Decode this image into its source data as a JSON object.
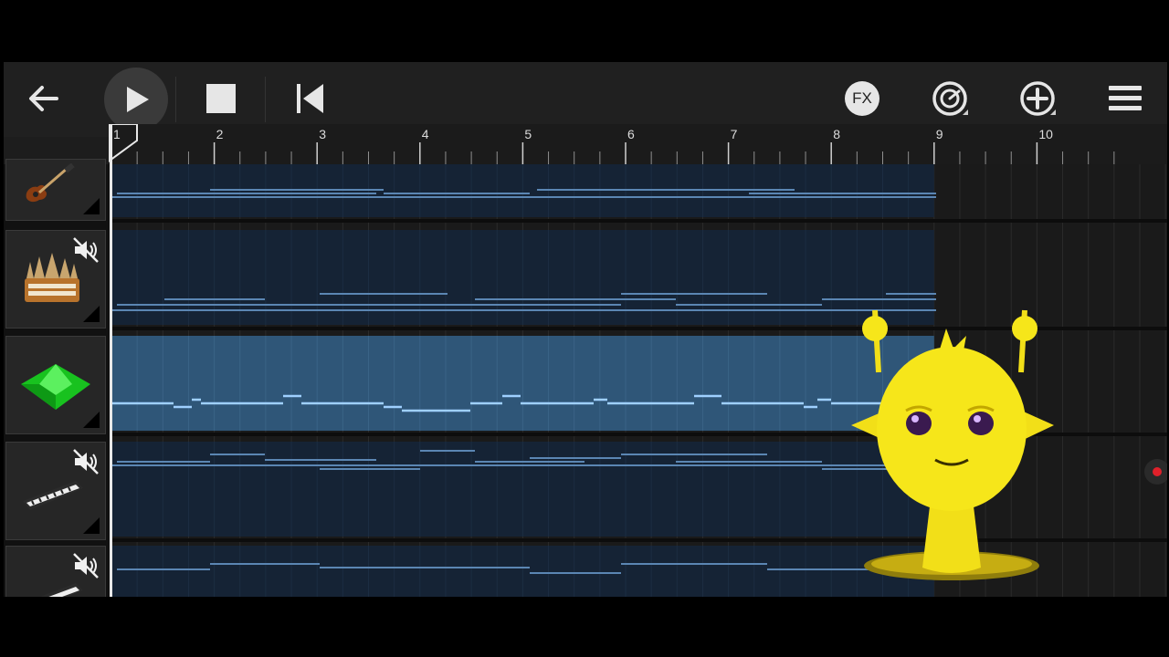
{
  "toolbar": {
    "back_icon": "arrow-left-icon",
    "play_icon": "play-icon",
    "stop_icon": "stop-icon",
    "rewind_icon": "skip-to-start-icon",
    "fx_label": "FX",
    "metronome_icon": "metronome-icon",
    "add_icon": "plus-circle-icon",
    "menu_icon": "hamburger-menu-icon"
  },
  "ruler": {
    "bar_labels": [
      "1",
      "2",
      "3",
      "4",
      "5",
      "6",
      "7",
      "8",
      "9",
      "10"
    ],
    "loop_end_bar": 9
  },
  "tracks": [
    {
      "name": "bass-guitar",
      "icon": "electric-bass-icon",
      "muted": false,
      "selected": false
    },
    {
      "name": "organ",
      "icon": "pipe-organ-icon",
      "muted": true,
      "selected": false
    },
    {
      "name": "synth-gem",
      "icon": "green-gem-icon",
      "muted": false,
      "selected": true
    },
    {
      "name": "keyboard-1",
      "icon": "keyboard-synth-icon",
      "muted": true,
      "selected": false
    },
    {
      "name": "keyboard-2",
      "icon": "keyboard-synth-icon",
      "muted": true,
      "selected": false
    }
  ],
  "colors": {
    "accent_selected_lane": "#2f5678",
    "lane_region": "#152335",
    "note_line": "#5b86b3",
    "selected_note_line": "#9fd0ff",
    "mascot_yellow": "#f6e61a",
    "record_dot": "#e0202a"
  },
  "overlay": {
    "mascot": "yellow-alien-character"
  }
}
